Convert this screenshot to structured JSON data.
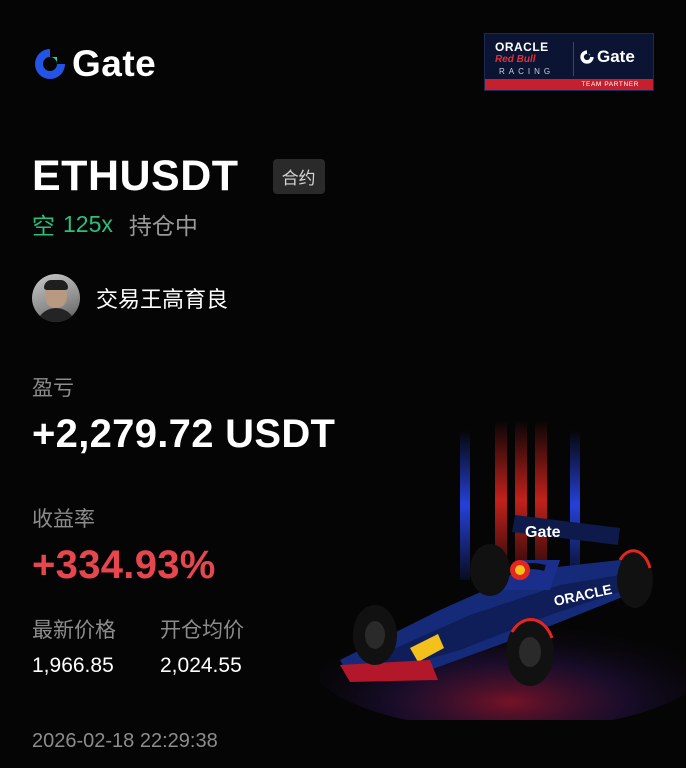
{
  "brand": {
    "name": "Gate",
    "color": "#2354e6"
  },
  "partner_badge": {
    "oracle": "ORACLE",
    "redbull": "Red Bull",
    "racing": "RACING",
    "gate": "Gate",
    "team_partner": "TEAM PARTNER"
  },
  "position": {
    "pair": "ETHUSDT",
    "contract_tag": "合约",
    "direction": "空",
    "leverage": "125x",
    "status": "持仓中",
    "direction_color": "#2bbf7f"
  },
  "trader": {
    "name": "交易王高育良"
  },
  "pnl": {
    "label": "盈亏",
    "value": "+2,279.72 USDT"
  },
  "roi": {
    "label": "收益率",
    "value": "+334.93%",
    "color": "#e6474f"
  },
  "prices": {
    "latest_label": "最新价格",
    "latest_value": "1,966.85",
    "entry_label": "开仓均价",
    "entry_value": "2,024.55"
  },
  "timestamp": "2026-02-18 22:29:38"
}
